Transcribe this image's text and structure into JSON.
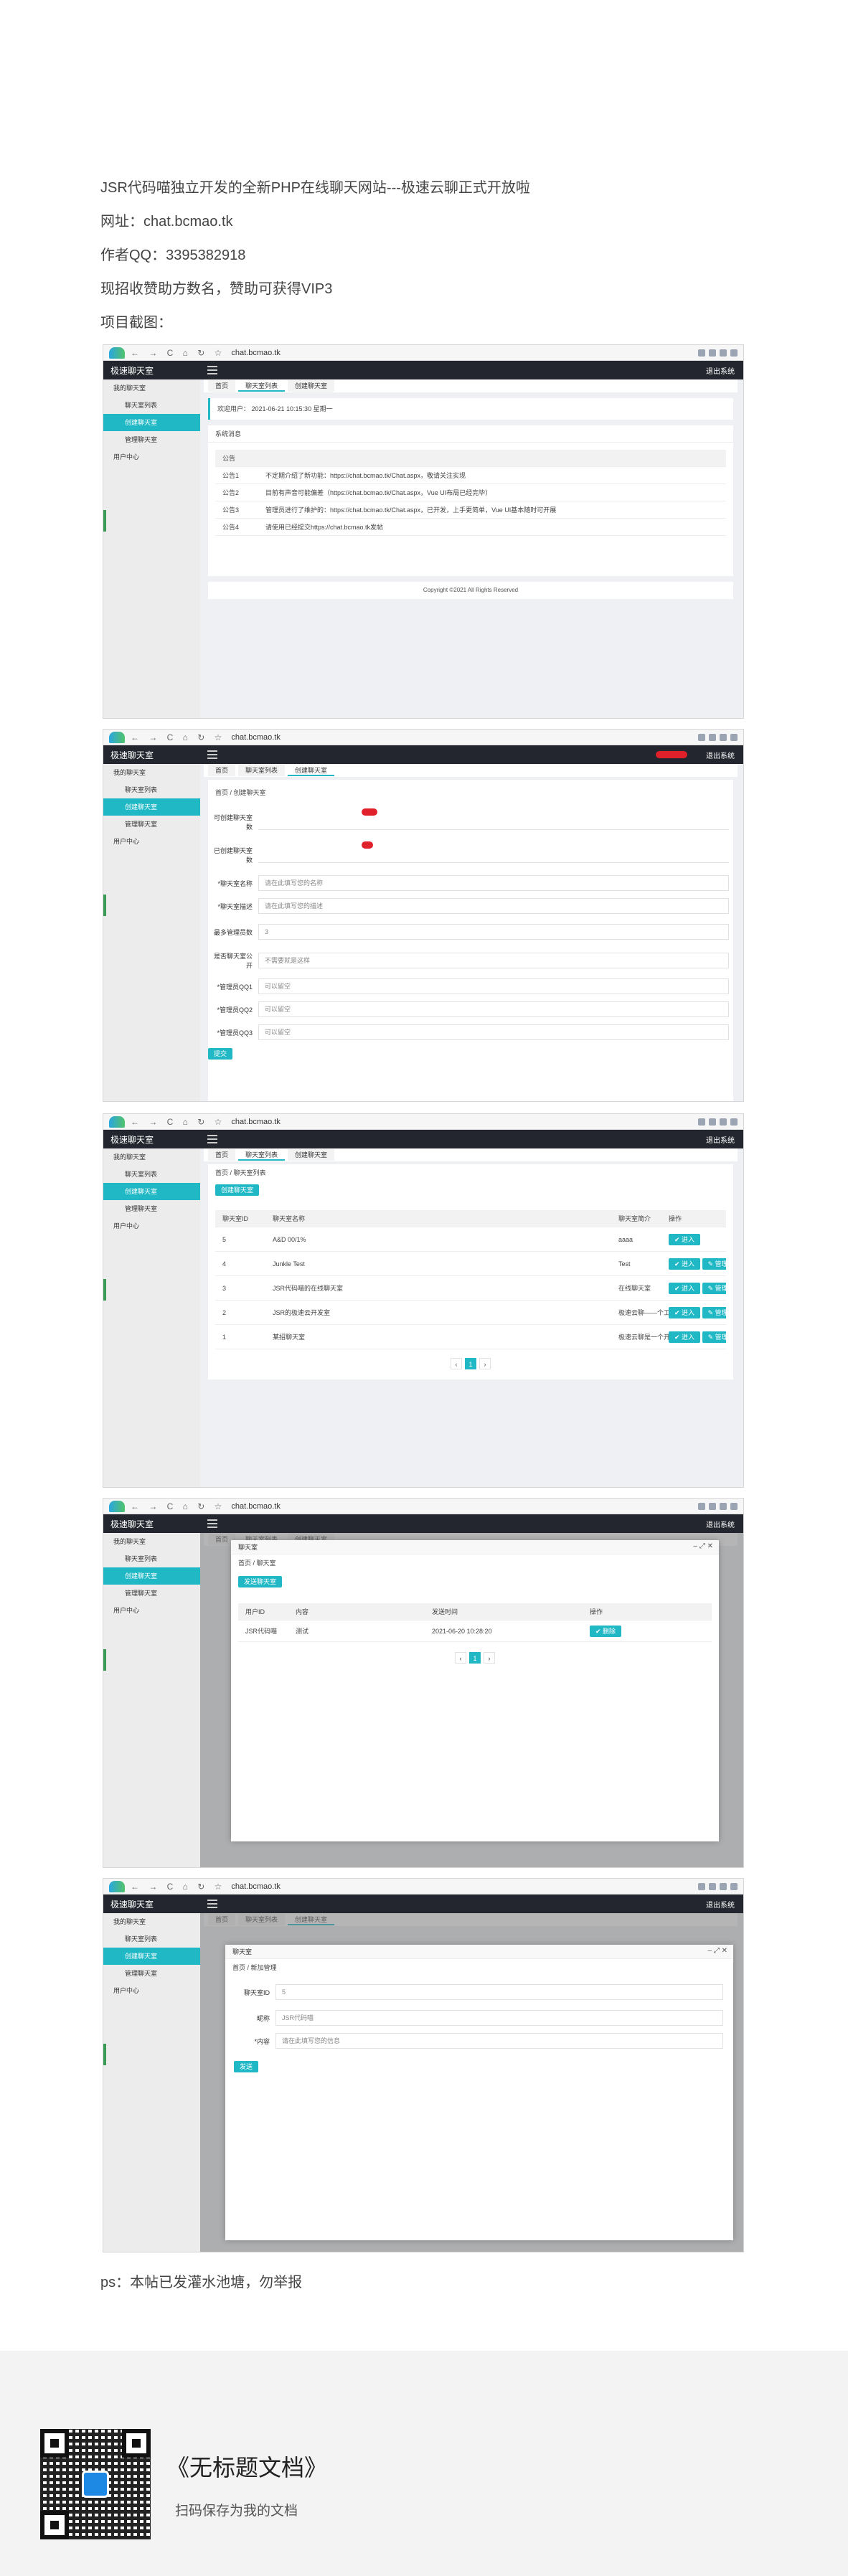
{
  "intro": {
    "line1": "JSR代码喵独立开发的全新PHP在线聊天网站---极速云聊正式开放啦",
    "line2": "网址：chat.bcmao.tk",
    "line3": "作者QQ：3395382918",
    "line4": "现招收赞助方数名，赞助可获得VIP3",
    "line5": "项目截图："
  },
  "browser": {
    "url": "chat.bcmao.tk",
    "nav": "← → C ⌂ ↻ ☆"
  },
  "app": {
    "brand": "极速聊天室",
    "user": "退出系统",
    "sidebar": [
      "我的聊天室",
      "聊天室列表",
      "创建聊天室",
      "管理聊天室",
      "用户中心"
    ],
    "tabs": [
      "首页",
      "聊天室列表",
      "创建聊天室"
    ]
  },
  "shot1": {
    "welcome": "欢迎用户：  2021-06-21 10:15:30 星期一",
    "notice_title": "系统消息",
    "notice_header": "公告",
    "notices": [
      {
        "tag": "公告1",
        "text": "不定期介绍了新功能：https://chat.bcmao.tk/Chat.aspx，敬请关注实现"
      },
      {
        "tag": "公告2",
        "text": "目前有声音可能偏差（https://chat.bcmao.tk/Chat.aspx，Vue UI布局已经完毕）"
      },
      {
        "tag": "公告3",
        "text": "管理员进行了维护的：https://chat.bcmao.tk/Chat.aspx，已开发，上手更简单，Vue UI基本随时可开展"
      },
      {
        "tag": "公告4",
        "text": "请使用已经提交https://chat.bcmao.tk发帖"
      }
    ],
    "copyright": "Copyright ©2021 All Rights Reserved"
  },
  "shot2": {
    "breadcrumb": "首页 / 创建聊天室",
    "fields": [
      {
        "label": "可创建聊天室数",
        "value": ""
      },
      {
        "label": "已创建聊天室数",
        "value": ""
      },
      {
        "label": "*聊天室名称",
        "value": "请在此填写您的名称"
      },
      {
        "label": "*聊天室描述",
        "value": "请在此填写您的描述"
      },
      {
        "label": "最多管理员数",
        "value": "3"
      },
      {
        "label": "是否聊天室公开",
        "value": "不需要就是这样"
      },
      {
        "label": "*管理员QQ1",
        "value": "可以留空"
      },
      {
        "label": "*管理员QQ2",
        "value": "可以留空"
      },
      {
        "label": "*管理员QQ3",
        "value": "可以留空"
      }
    ],
    "submit": "提交"
  },
  "shot3": {
    "breadcrumb": "首页 / 聊天室列表",
    "create_btn": "创建聊天室",
    "headers": [
      "聊天室ID",
      "聊天室名称",
      "聊天室简介",
      "操作"
    ],
    "rows": [
      {
        "id": "5",
        "name": "A&D 00/1%",
        "desc": "aaaa"
      },
      {
        "id": "4",
        "name": "Junkle Test",
        "desc": "Test"
      },
      {
        "id": "3",
        "name": "JSR代码喵的在线聊天室",
        "desc": "在线聊天室"
      },
      {
        "id": "2",
        "name": "JSR的极速云开发室",
        "desc": "极速云聊——个工作室"
      },
      {
        "id": "1",
        "name": "某招聊天室",
        "desc": "极速云聊是一个开发者的讨论"
      }
    ],
    "enter": "✔ 进入",
    "manage": "✎ 管理",
    "page": "1"
  },
  "shot4": {
    "modal_title": "聊天室",
    "breadcrumb": "首页 / 聊天室",
    "btn": "发送聊天室",
    "headers": [
      "用户ID",
      "内容",
      "发送时间",
      "操作"
    ],
    "row": {
      "uid": "JSR代码喵",
      "content": "测试",
      "time": "2021-06-20 10:28:20",
      "op": "✔ 删除"
    },
    "page": "1"
  },
  "shot5": {
    "modal_title": "聊天室",
    "breadcrumb": "首页 / 新加管理",
    "fields": [
      {
        "label": "聊天室ID",
        "value": "5"
      },
      {
        "label": "昵称",
        "value": "JSR代码喵"
      },
      {
        "label": "*内容",
        "value": "请在此填写您的信息"
      }
    ],
    "submit": "发送"
  },
  "ps": "ps：本帖已发灌水池塘，勿举报",
  "footer": {
    "title": "《无标题文档》",
    "sub": "扫码保存为我的文档"
  }
}
